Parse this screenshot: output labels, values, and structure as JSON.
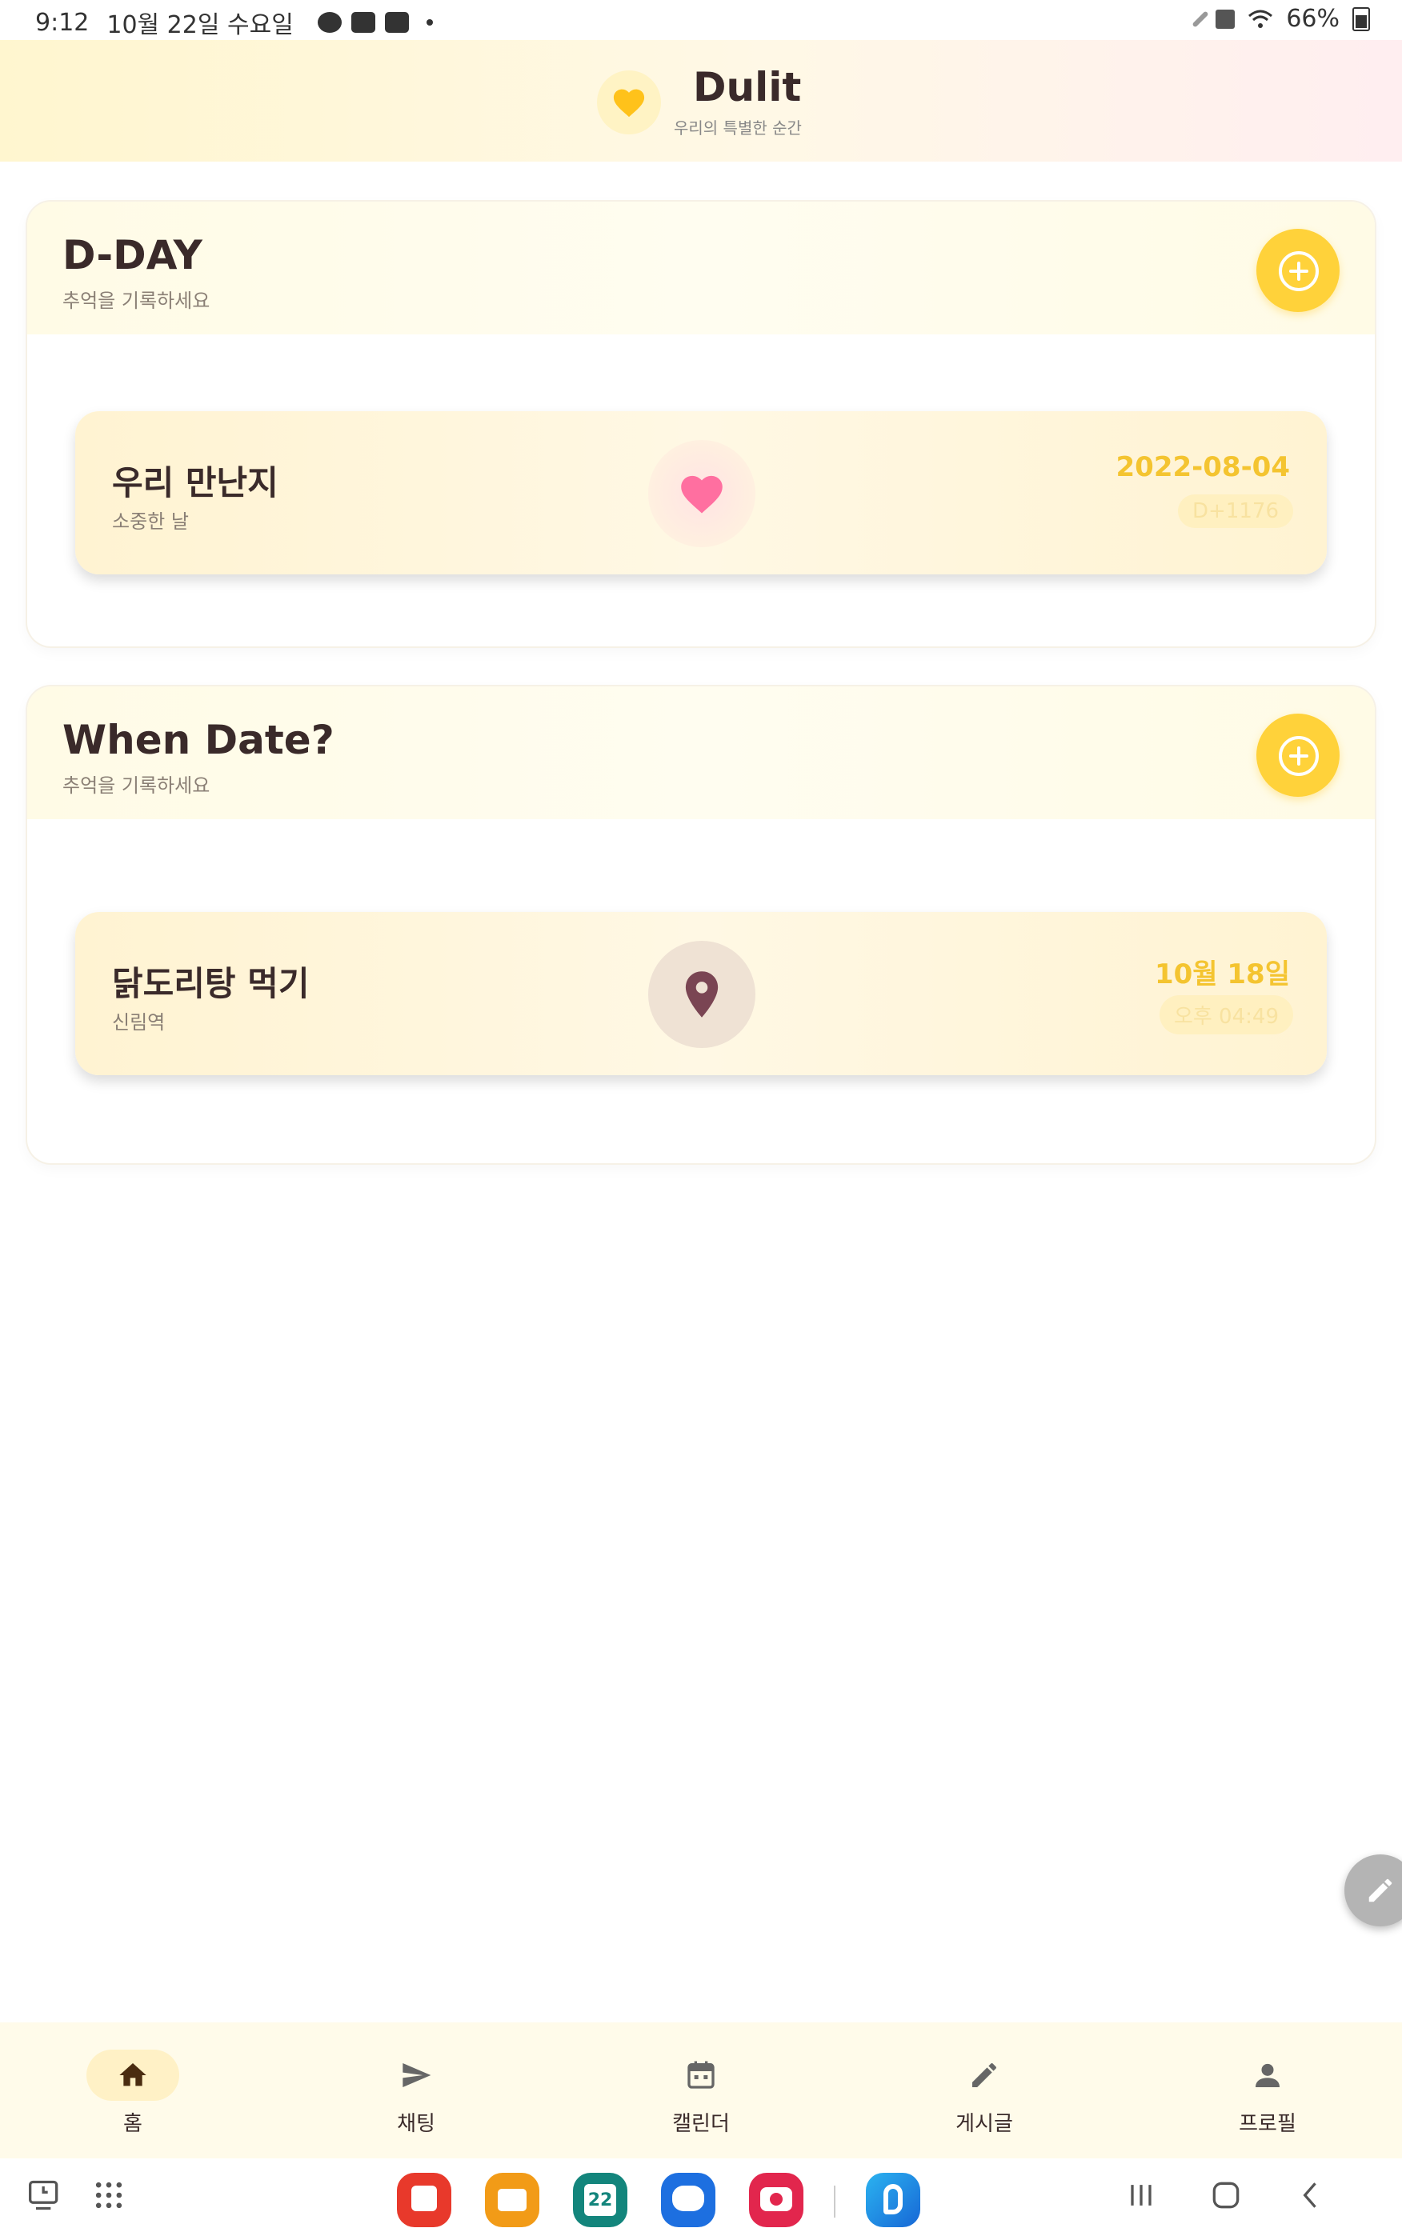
{
  "status_bar": {
    "time": "9:12",
    "date": "10월 22일 수요일",
    "notification_icons": [
      "kakaotalk-icon",
      "gallery-icon",
      "screenshot-icon"
    ],
    "battery": "66%"
  },
  "header": {
    "title": "Dulit",
    "subtitle": "우리의 특별한 순간",
    "logo_icon": "heart-icon"
  },
  "dday_section": {
    "title": "D-DAY",
    "subtitle": "추억을 기록하세요",
    "card": {
      "title": "우리 만난지",
      "subtitle": "소중한 날",
      "icon": "heart-icon",
      "date": "2022-08-04",
      "badge": "D+1176"
    }
  },
  "date_section": {
    "title": "When Date?",
    "subtitle": "추억을 기록하세요",
    "card": {
      "title": "닭도리탕 먹기",
      "subtitle": "신림역",
      "icon": "location-pin-icon",
      "date": "10월 18일",
      "badge": "오후 04:49"
    }
  },
  "bottom_nav": [
    {
      "label": "홈",
      "icon": "home-icon",
      "active": true
    },
    {
      "label": "채팅",
      "icon": "send-icon",
      "active": false
    },
    {
      "label": "캘린더",
      "icon": "calendar-icon",
      "active": false
    },
    {
      "label": "게시글",
      "icon": "pencil-icon",
      "active": false
    },
    {
      "label": "프로필",
      "icon": "person-icon",
      "active": false
    }
  ],
  "taskbar": {
    "calendar_day": "22"
  },
  "colors": {
    "accent": "#FFD23A",
    "date_text": "#F4C430",
    "heart": "#FF6FA0",
    "pin": "#7A4553",
    "text": "#3A2A2A"
  }
}
